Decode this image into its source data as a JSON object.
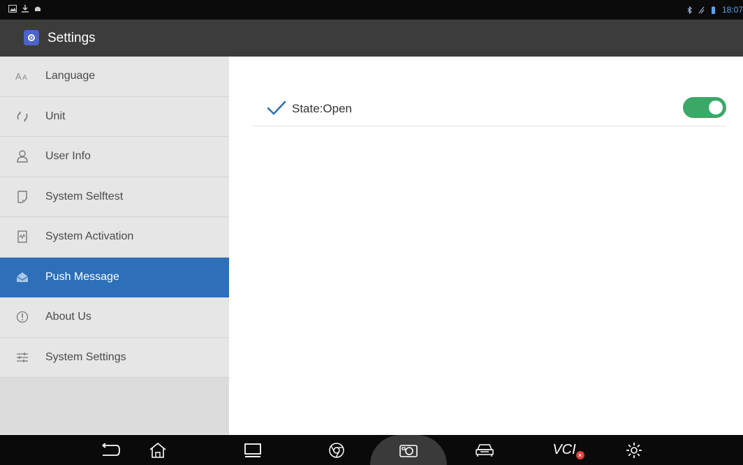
{
  "status_bar": {
    "time": "18:07",
    "left_icons": [
      "image-icon",
      "download-icon",
      "android-icon"
    ],
    "right_icons": [
      "bluetooth-icon",
      "signal-icon",
      "battery-icon"
    ]
  },
  "header": {
    "title": "Settings",
    "icon": "settings-app-icon"
  },
  "sidebar": {
    "items": [
      {
        "label": "Language",
        "icon": "language-icon"
      },
      {
        "label": "Unit",
        "icon": "unit-icon"
      },
      {
        "label": "User Info",
        "icon": "user-icon"
      },
      {
        "label": "System Selftest",
        "icon": "selftest-icon"
      },
      {
        "label": "System Activation",
        "icon": "activation-icon"
      },
      {
        "label": "Push Message",
        "icon": "message-icon",
        "active": true
      },
      {
        "label": "About Us",
        "icon": "info-icon"
      },
      {
        "label": "System Settings",
        "icon": "sliders-icon"
      }
    ]
  },
  "main": {
    "state_label": "State:Open",
    "toggle_on": true
  },
  "navbar": {
    "vci_label": "VCI",
    "buttons": [
      "back-icon",
      "home-icon",
      "recents-icon",
      "browser-icon",
      "camera-icon",
      "car-icon",
      "vci-icon",
      "gear-icon"
    ]
  },
  "colors": {
    "accent": "#2d6fb8",
    "toggle": "#3aa867",
    "header_bg": "#3c3c3c"
  }
}
